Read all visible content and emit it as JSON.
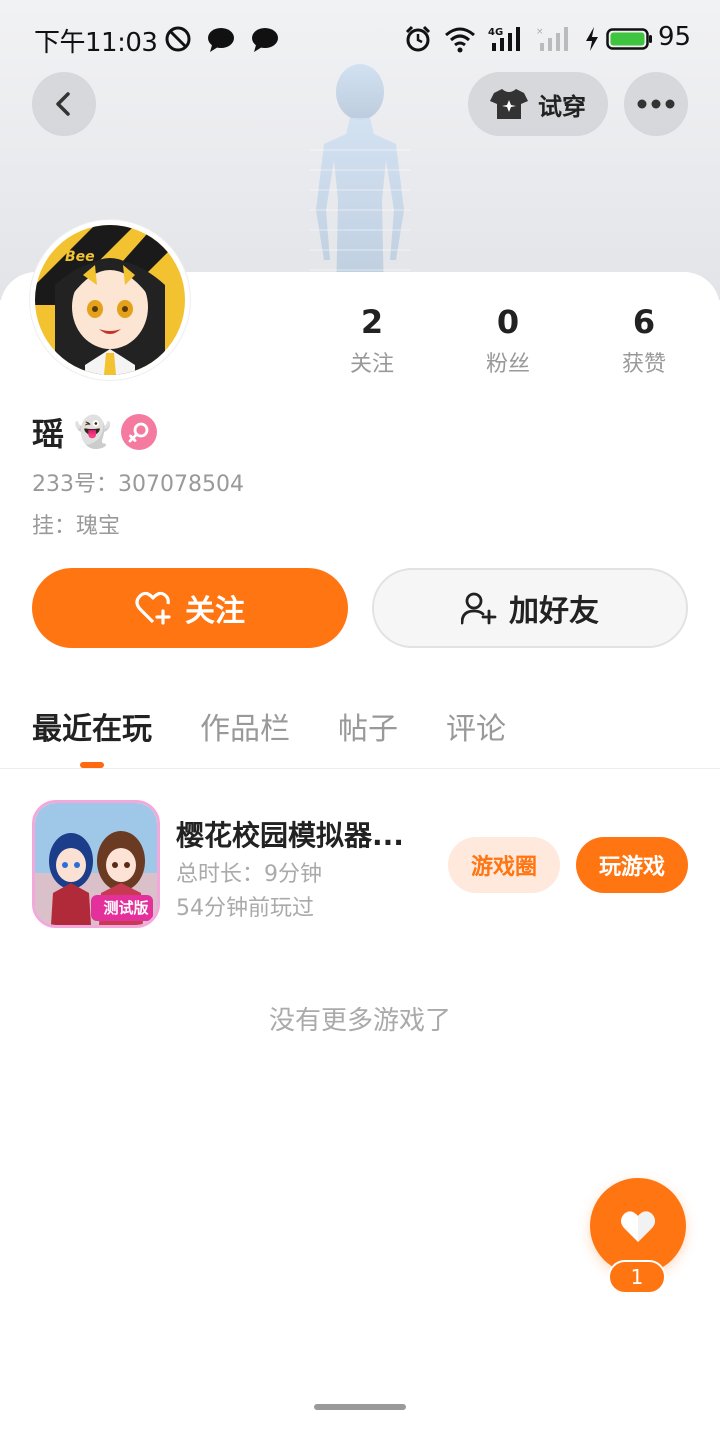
{
  "status_bar": {
    "time": "下午11:03",
    "battery_percent": "95",
    "icons": [
      "dnd-icon",
      "chat-bubble-icon",
      "chat-bubble-icon",
      "alarm-icon",
      "wifi-icon",
      "signal-4g-icon",
      "signal-none-icon",
      "charging-icon",
      "battery-icon"
    ]
  },
  "header": {
    "back_icon": "chevron-left-icon",
    "tryon_label": "试穿",
    "tryon_icon": "tshirt-sparkle-icon",
    "more_icon": "more-dots-icon"
  },
  "profile": {
    "stats": [
      {
        "value": "2",
        "label": "关注"
      },
      {
        "value": "0",
        "label": "粉丝"
      },
      {
        "value": "6",
        "label": "获赞"
      }
    ],
    "username": "瑶",
    "username_emoji": "👻",
    "gender": "female",
    "id_line": "233号：307078504",
    "guild_line": "挂：瑰宝"
  },
  "actions": {
    "follow_label": "关注",
    "add_friend_label": "加好友"
  },
  "tabs": [
    {
      "label": "最近在玩",
      "active": true
    },
    {
      "label": "作品栏",
      "active": false
    },
    {
      "label": "帖子",
      "active": false
    },
    {
      "label": "评论",
      "active": false
    }
  ],
  "games": [
    {
      "title": "樱花校园模拟器...",
      "duration": "总时长：9分钟",
      "last_played": "54分钟前玩过",
      "icon_badge": "测试版",
      "circle_label": "游戏圈",
      "play_label": "玩游戏"
    }
  ],
  "empty_text": "没有更多游戏了",
  "like": {
    "count": "1",
    "icon": "heart-icon"
  },
  "colors": {
    "accent": "#ff7512",
    "accent_soft": "#ffe9dc",
    "gender_female": "#f47aa0"
  }
}
